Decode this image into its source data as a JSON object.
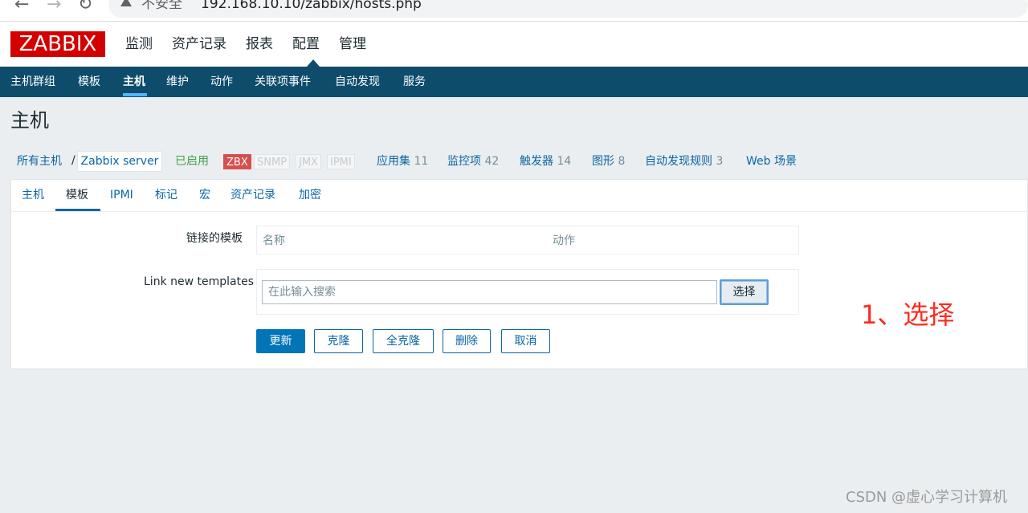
{
  "browser": {
    "security_label": "不安全",
    "url": "192.168.10.10/zabbix/hosts.php"
  },
  "logo": "ZABBIX",
  "main_menu": [
    "监测",
    "资产记录",
    "报表",
    "配置",
    "管理"
  ],
  "sub_menu": [
    "主机群组",
    "模板",
    "主机",
    "维护",
    "动作",
    "关联项事件",
    "自动发现",
    "服务"
  ],
  "page_title": "主机",
  "breadcrumb": {
    "all_hosts": "所有主机",
    "separator": "/",
    "current_host": "Zabbix server",
    "status": "已启用"
  },
  "availability": [
    "ZBX",
    "SNMP",
    "JMX",
    "IPMI"
  ],
  "host_links": [
    {
      "label": "应用集",
      "count": "11"
    },
    {
      "label": "监控项",
      "count": "42"
    },
    {
      "label": "触发器",
      "count": "14"
    },
    {
      "label": "图形",
      "count": "8"
    },
    {
      "label": "自动发现规则",
      "count": "3"
    },
    {
      "label": "Web 场景",
      "count": ""
    }
  ],
  "tabs": [
    "主机",
    "模板",
    "IPMI",
    "标记",
    "宏",
    "资产记录",
    "加密"
  ],
  "form": {
    "linked_templates_label": "链接的模板",
    "col_name": "名称",
    "col_action": "动作",
    "link_new_label": "Link new templates",
    "search_placeholder": "在此输入搜索",
    "select_button": "选择"
  },
  "buttons": {
    "update": "更新",
    "clone": "克隆",
    "full_clone": "全克隆",
    "delete": "删除",
    "cancel": "取消"
  },
  "annotation": "1、选择",
  "watermark": "CSDN @虚心学习计算机",
  "colors": {
    "brand_red": "#d40000",
    "nav_dark": "#0e4c6c",
    "link_blue": "#0a66a5",
    "enabled_green": "#429e47",
    "annotation_red": "#ff2a1f"
  }
}
